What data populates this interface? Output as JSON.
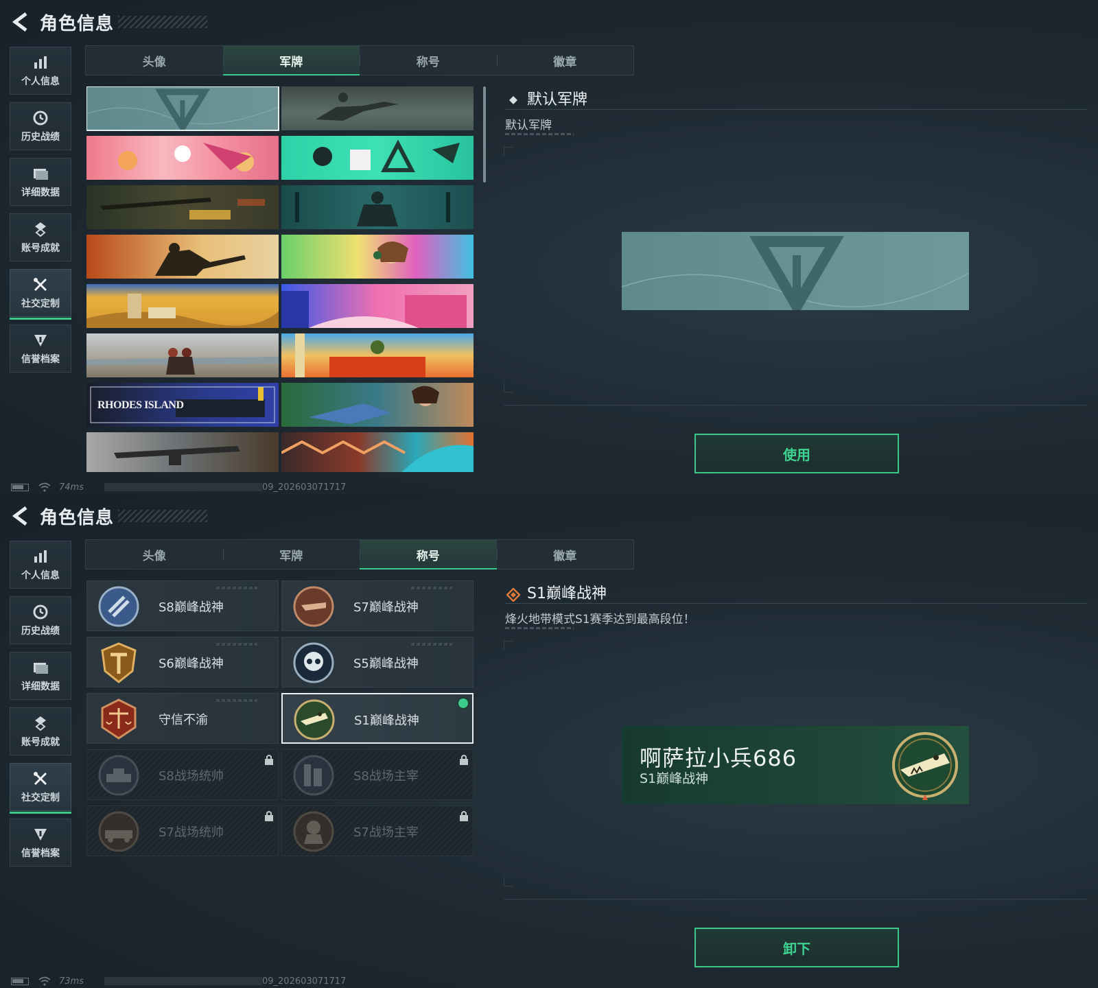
{
  "header": {
    "title": "角色信息"
  },
  "sidebar": {
    "items": [
      {
        "label": "个人信息",
        "icon": "bar-chart-icon"
      },
      {
        "label": "历史战绩",
        "icon": "history-clock-icon"
      },
      {
        "label": "详细数据",
        "icon": "folder-icon"
      },
      {
        "label": "账号成就",
        "icon": "achievement-icon"
      },
      {
        "label": "社交定制",
        "icon": "tools-icon",
        "active": true
      },
      {
        "label": "信誉档案",
        "icon": "shield-arrow-icon"
      }
    ]
  },
  "tabs": [
    "头像",
    "军牌",
    "称号",
    "徽章"
  ],
  "screen1": {
    "active_tab": "军牌",
    "plates": [
      {
        "text": ""
      },
      {
        "text": ""
      },
      {
        "text": ""
      },
      {
        "text": ""
      },
      {
        "text": ""
      },
      {
        "text": ""
      },
      {
        "text": ""
      },
      {
        "text": ""
      },
      {
        "text": ""
      },
      {
        "text": ""
      },
      {
        "text": ""
      },
      {
        "text": ""
      },
      {
        "text": "RHODES ISLAND"
      },
      {
        "text": ""
      },
      {
        "text": ""
      },
      {
        "text": ""
      }
    ],
    "detail": {
      "title": "默认军牌",
      "description": "默认军牌"
    },
    "action_label": "使用",
    "status": {
      "ping": "74ms",
      "build": "09_202603071717"
    }
  },
  "screen2": {
    "active_tab": "称号",
    "titles": [
      {
        "name": "S8巅峰战神",
        "medal": "s8-medal-icon",
        "locked": false
      },
      {
        "name": "S7巅峰战神",
        "medal": "s7-medal-icon",
        "locked": false
      },
      {
        "name": "S6巅峰战神",
        "medal": "s6-medal-icon",
        "locked": false
      },
      {
        "name": "S5巅峰战神",
        "medal": "s5-skull-medal-icon",
        "locked": false
      },
      {
        "name": "守信不渝",
        "medal": "scales-medal-icon",
        "locked": false
      },
      {
        "name": "S1巅峰战神",
        "medal": "crocodile-medal-icon",
        "locked": false,
        "selected": true,
        "equipped": true
      },
      {
        "name": "S8战场统帅",
        "medal": "tank-medal-icon",
        "locked": true
      },
      {
        "name": "S8战场主宰",
        "medal": "building-medal-icon",
        "locked": true
      },
      {
        "name": "S7战场统帅",
        "medal": "vehicle-medal-icon",
        "locked": true
      },
      {
        "name": "S7战场主宰",
        "medal": "soldier-medal-icon",
        "locked": true
      }
    ],
    "detail": {
      "title": "S1巅峰战神",
      "description": "烽火地带模式S1赛季达到最高段位！"
    },
    "name_card": {
      "player_name": "啊萨拉小兵686",
      "title": "S1巅峰战神"
    },
    "action_label": "卸下",
    "status": {
      "ping": "73ms",
      "build": "09_202603071717"
    }
  },
  "colors": {
    "accent": "#3cc98a",
    "background": "#1d2730",
    "text": "#c9d2d8"
  }
}
